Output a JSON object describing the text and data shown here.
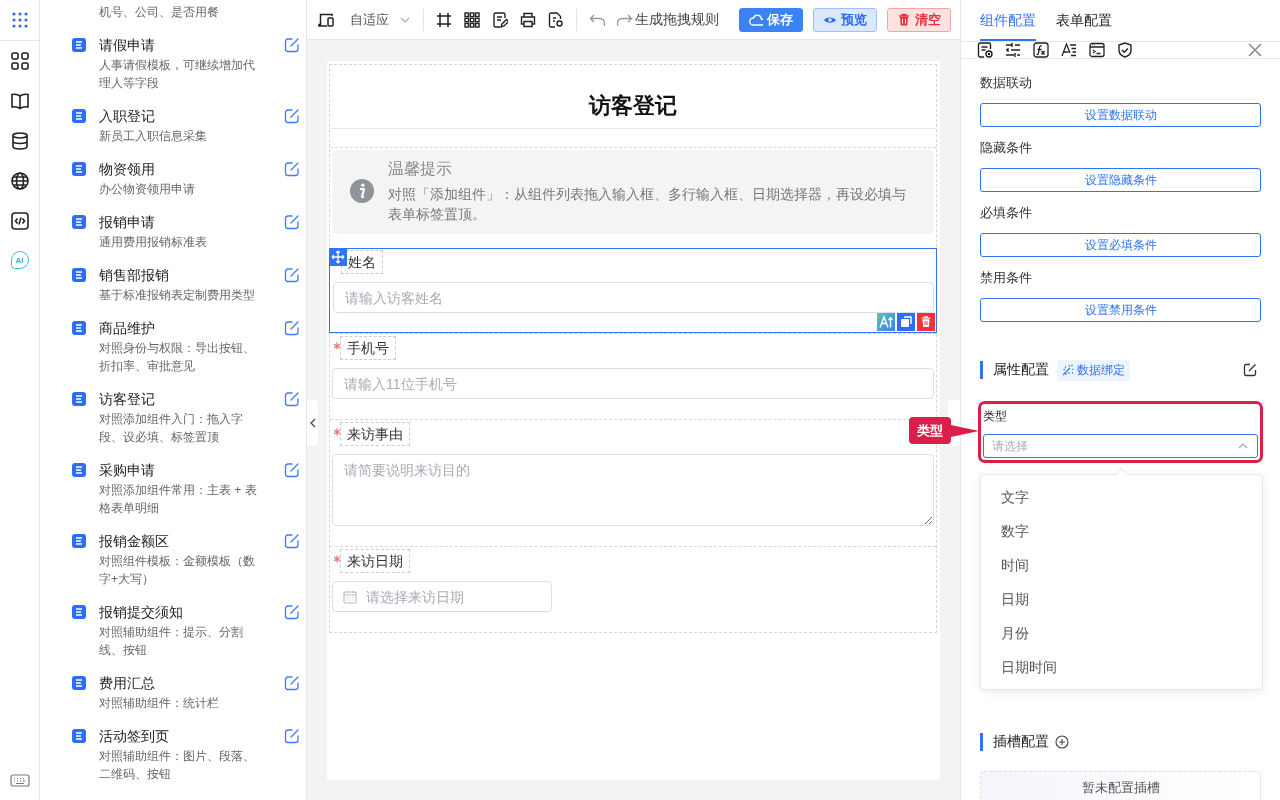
{
  "rail": {
    "assistant_label": "AI"
  },
  "template_list": [
    {
      "description": "机号、公司、是否用餐"
    },
    {
      "title": "请假申请",
      "description": "人事请假模板，可继续增加代理人等字段"
    },
    {
      "title": "入职登记",
      "description": "新员工入职信息采集"
    },
    {
      "title": "物资领用",
      "description": "办公物资领用申请"
    },
    {
      "title": "报销申请",
      "description": "通用费用报销标准表"
    },
    {
      "title": "销售部报销",
      "description": "基于标准报销表定制费用类型"
    },
    {
      "title": "商品维护",
      "description": "对照身份与权限：导出按钮、折扣率、审批意见"
    },
    {
      "title": "访客登记",
      "description": "对照添加组件入门：拖入字段、设必填、标签置顶"
    },
    {
      "title": "采购申请",
      "description": "对照添加组件常用：主表 + 表格表单明细"
    },
    {
      "title": "报销金额区",
      "description": "对照组件模板：金额模板（数字+大写）"
    },
    {
      "title": "报销提交须知",
      "description": "对照辅助组件：提示、分割线、按钮"
    },
    {
      "title": "费用汇总",
      "description": "对照辅助组件：统计栏"
    },
    {
      "title": "活动签到页",
      "description": "对照辅助组件：图片、段落、二维码、按钮"
    }
  ],
  "toolbar": {
    "layout_select": "自适应",
    "generate_rule": "生成拖拽规则",
    "buttons": [
      {
        "label": "保存",
        "kind": "primary"
      },
      {
        "label": "预览",
        "kind": "info"
      },
      {
        "label": "清空",
        "kind": "danger"
      }
    ]
  },
  "form": {
    "title": "访客登记",
    "notice": {
      "title": "温馨提示",
      "text": "对照「添加组件」：从组件列表拖入输入框、多行输入框、日期选择器，再设必填与表单标签置顶。"
    },
    "fields": [
      {
        "label": "姓名",
        "kind": "input",
        "placeholder": "请输入访客姓名",
        "required": false,
        "selected": true
      },
      {
        "label": "手机号",
        "kind": "input",
        "placeholder": "请输入11位手机号",
        "required": true,
        "selected": false
      },
      {
        "label": "来访事由",
        "kind": "textarea",
        "placeholder": "请简要说明来访目的",
        "required": true,
        "selected": false
      },
      {
        "label": "来访日期",
        "kind": "date",
        "placeholder": "请选择来访日期",
        "required": true,
        "selected": false
      }
    ]
  },
  "config_panel": {
    "tabs": [
      {
        "label": "组件配置",
        "selected": true
      },
      {
        "label": "表单配置",
        "selected": false
      }
    ],
    "conditions": [
      {
        "label": "数据联动",
        "button": "设置数据联动"
      },
      {
        "label": "隐藏条件",
        "button": "设置隐藏条件"
      },
      {
        "label": "必填条件",
        "button": "设置必填条件"
      },
      {
        "label": "禁用条件",
        "button": "设置禁用条件"
      }
    ],
    "property_section": {
      "title": "属性配置",
      "badge": "数据绑定",
      "field": {
        "label": "类型",
        "placeholder": "请选择",
        "expanded": true,
        "highlighted": true,
        "callout": "类型"
      },
      "options": [
        "文字",
        "数字",
        "时间",
        "日期",
        "月份",
        "日期时间"
      ]
    },
    "slot_section": {
      "title": "插槽配置",
      "empty_text": "暂未配置插槽"
    }
  }
}
